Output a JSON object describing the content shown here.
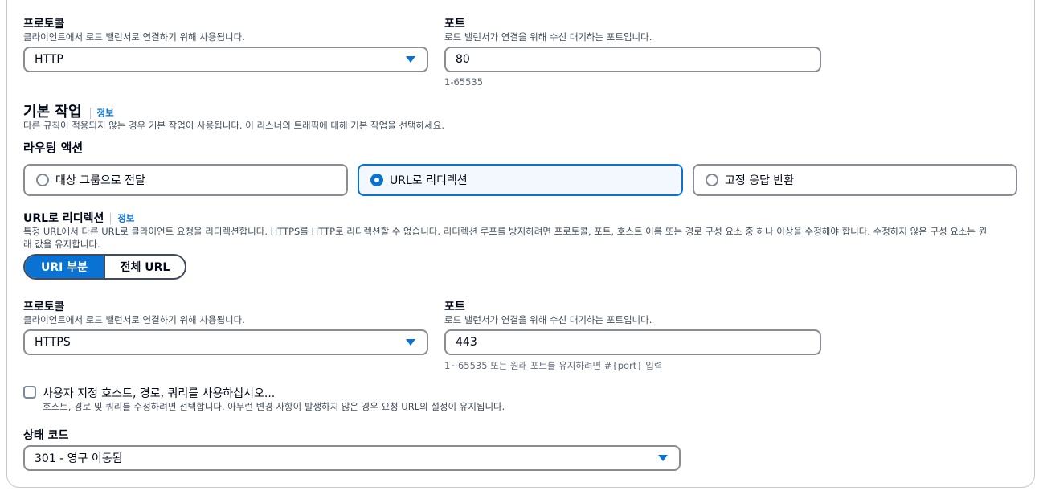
{
  "listener": {
    "protocol": {
      "label": "프로토콜",
      "description": "클라이언트에서 로드 밸런서로 연결하기 위해 사용됩니다.",
      "value": "HTTP"
    },
    "port": {
      "label": "포트",
      "description": "로드 밸런서가 연결을 위해 수신 대기하는 포트입니다.",
      "value": "80",
      "hint": "1-65535"
    }
  },
  "default_action": {
    "title": "기본 작업",
    "info": "정보",
    "description": "다른 규칙이 적용되지 않는 경우 기본 작업이 사용됩니다. 이 리스너의 트래픽에 대해 기본 작업을 선택하세요.",
    "routing_label": "라우팅 액션",
    "options": [
      {
        "label": "대상 그룹으로 전달",
        "selected": false
      },
      {
        "label": "URL로 리디렉션",
        "selected": true
      },
      {
        "label": "고정 응답 반환",
        "selected": false
      }
    ]
  },
  "redirect": {
    "title": "URL로 리디렉션",
    "info": "정보",
    "description_line1": "특정 URL에서 다른 URL로 클라이언트 요청을 리디렉션합니다. HTTPS를 HTTP로 리디렉션할 수 없습니다. 리디렉션 루프를 방지하려면 프로토콜, 포트, 호스트 이름 또는 경로 구성 요소 중 하나 이상을 수정해야 합니다. 수정하지 않은 구성 요소는 원",
    "description_line2": "래 값을 유지합니다.",
    "segments": [
      "URI 부분",
      "전체 URL"
    ],
    "protocol": {
      "label": "프로토콜",
      "description": "클라이언트에서 로드 밸런서로 연결하기 위해 사용됩니다.",
      "value": "HTTPS"
    },
    "port": {
      "label": "포트",
      "description": "로드 밸런서가 연결을 위해 수신 대기하는 포트입니다.",
      "value": "443",
      "hint": "1~65535 또는 원래 포트를 유지하려면 #{port} 입력"
    },
    "custom": {
      "label": "사용자 지정 호스트, 경로, 쿼리를 사용하십시오...",
      "description": "호스트, 경로 및 쿼리를 수정하려면 선택합니다. 아무런 변경 사항이 발생하지 않은 경우 요청 URL의 설정이 유지됩니다.",
      "checked": false
    },
    "status": {
      "label": "상태 코드",
      "value": "301 - 영구 이동됨"
    }
  },
  "colors": {
    "accent": "#0972d3",
    "selected_tile_bg": "#f2f8fd",
    "border": "#8c8c94"
  }
}
